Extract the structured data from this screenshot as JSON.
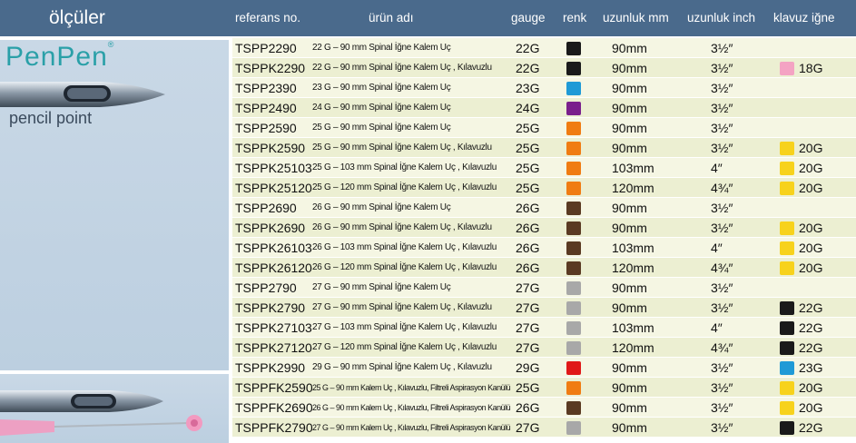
{
  "left": {
    "header": "ölçüler",
    "brand": "PenPen",
    "registered": "®",
    "tagline": "pencil point"
  },
  "columns": {
    "ref": "referans no.",
    "name": "ürün adı",
    "gauge": "gauge",
    "color": "renk",
    "length_mm": "uzunluk mm",
    "length_inch": "uzunluk inch",
    "guide": "klavuz iğne"
  },
  "colors": {
    "black": "#1a1a1a",
    "blue": "#1f9ad6",
    "purple": "#7a1f8c",
    "orange": "#f07c12",
    "brown": "#5a3a22",
    "gray": "#a8a8a8",
    "red": "#e01818",
    "pink": "#f4a3c3",
    "yellow": "#f7d21c",
    "header_bg": "#4a6a8c"
  },
  "rows": [
    {
      "ref": "TSPP2290",
      "name": "22 G – 90 mm Spinal İğne Kalem Uç",
      "gauge": "22G",
      "color": "#1a1a1a",
      "mm": "90mm",
      "inch": "3½″",
      "guide_color": "",
      "guide": ""
    },
    {
      "ref": "TSPPK2290",
      "name": "22 G – 90 mm Spinal İğne Kalem Uç , Kılavuzlu",
      "gauge": "22G",
      "color": "#1a1a1a",
      "mm": "90mm",
      "inch": "3½″",
      "guide_color": "#f4a3c3",
      "guide": "18G"
    },
    {
      "ref": "TSPP2390",
      "name": "23 G – 90 mm Spinal İğne Kalem Uç",
      "gauge": "23G",
      "color": "#1f9ad6",
      "mm": "90mm",
      "inch": "3½″",
      "guide_color": "",
      "guide": ""
    },
    {
      "ref": "TSPP2490",
      "name": "24 G – 90 mm Spinal İğne Kalem Uç",
      "gauge": "24G",
      "color": "#7a1f8c",
      "mm": "90mm",
      "inch": "3½″",
      "guide_color": "",
      "guide": ""
    },
    {
      "ref": "TSPP2590",
      "name": "25 G – 90 mm Spinal İğne Kalem Uç",
      "gauge": "25G",
      "color": "#f07c12",
      "mm": "90mm",
      "inch": "3½″",
      "guide_color": "",
      "guide": ""
    },
    {
      "ref": "TSPPK2590",
      "name": "25 G – 90 mm Spinal İğne Kalem Uç , Kılavuzlu",
      "gauge": "25G",
      "color": "#f07c12",
      "mm": "90mm",
      "inch": "3½″",
      "guide_color": "#f7d21c",
      "guide": "20G"
    },
    {
      "ref": "TSPPK25103",
      "name": "25 G – 103 mm Spinal İğne Kalem Uç , Kılavuzlu",
      "gauge": "25G",
      "color": "#f07c12",
      "mm": "103mm",
      "inch": "4″",
      "guide_color": "#f7d21c",
      "guide": "20G"
    },
    {
      "ref": "TSPPK25120",
      "name": "25 G – 120 mm Spinal İğne Kalem Uç , Kılavuzlu",
      "gauge": "25G",
      "color": "#f07c12",
      "mm": "120mm",
      "inch": "4¾″",
      "guide_color": "#f7d21c",
      "guide": "20G"
    },
    {
      "ref": "TSPP2690",
      "name": "26 G – 90 mm Spinal İğne Kalem Uç",
      "gauge": "26G",
      "color": "#5a3a22",
      "mm": "90mm",
      "inch": "3½″",
      "guide_color": "",
      "guide": ""
    },
    {
      "ref": "TSPPK2690",
      "name": "26 G – 90 mm Spinal İğne Kalem Uç , Kılavuzlu",
      "gauge": "26G",
      "color": "#5a3a22",
      "mm": "90mm",
      "inch": "3½″",
      "guide_color": "#f7d21c",
      "guide": "20G"
    },
    {
      "ref": "TSPPK26103",
      "name": "26 G – 103 mm Spinal İğne Kalem Uç , Kılavuzlu",
      "gauge": "26G",
      "color": "#5a3a22",
      "mm": "103mm",
      "inch": "4″",
      "guide_color": "#f7d21c",
      "guide": "20G"
    },
    {
      "ref": "TSPPK26120",
      "name": "26 G – 120 mm Spinal İğne Kalem Uç , Kılavuzlu",
      "gauge": "26G",
      "color": "#5a3a22",
      "mm": "120mm",
      "inch": "4¾″",
      "guide_color": "#f7d21c",
      "guide": "20G"
    },
    {
      "ref": "TSPP2790",
      "name": "27 G – 90 mm Spinal İğne Kalem Uç",
      "gauge": "27G",
      "color": "#a8a8a8",
      "mm": "90mm",
      "inch": "3½″",
      "guide_color": "",
      "guide": ""
    },
    {
      "ref": "TSPPK2790",
      "name": "27 G – 90 mm Spinal İğne Kalem Uç , Kılavuzlu",
      "gauge": "27G",
      "color": "#a8a8a8",
      "mm": "90mm",
      "inch": "3½″",
      "guide_color": "#1a1a1a",
      "guide": "22G"
    },
    {
      "ref": "TSPPK27103",
      "name": "27 G – 103 mm Spinal İğne Kalem Uç , Kılavuzlu",
      "gauge": "27G",
      "color": "#a8a8a8",
      "mm": "103mm",
      "inch": "4″",
      "guide_color": "#1a1a1a",
      "guide": "22G"
    },
    {
      "ref": "TSPPK27120",
      "name": "27 G – 120 mm Spinal İğne Kalem Uç , Kılavuzlu",
      "gauge": "27G",
      "color": "#a8a8a8",
      "mm": "120mm",
      "inch": "4¾″",
      "guide_color": "#1a1a1a",
      "guide": "22G"
    },
    {
      "ref": "TSPPK2990",
      "name": "29 G – 90 mm Spinal İğne Kalem Uç , Kılavuzlu",
      "gauge": "29G",
      "color": "#e01818",
      "mm": "90mm",
      "inch": "3½″",
      "guide_color": "#1f9ad6",
      "guide": "23G"
    },
    {
      "ref": "TSPPFK2590",
      "name": "25 G – 90 mm Kalem Uç , Kılavuzlu, Filtreli Aspirasyon Kanülü",
      "gauge": "25G",
      "color": "#f07c12",
      "mm": "90mm",
      "inch": "3½″",
      "guide_color": "#f7d21c",
      "guide": "20G"
    },
    {
      "ref": "TSPPFK2690",
      "name": "26 G – 90 mm Kalem Uç , Kılavuzlu, Filtreli Aspirasyon Kanülü",
      "gauge": "26G",
      "color": "#5a3a22",
      "mm": "90mm",
      "inch": "3½″",
      "guide_color": "#f7d21c",
      "guide": "20G"
    },
    {
      "ref": "TSPPFK2790",
      "name": "27 G – 90 mm Kalem Uç , Kılavuzlu, Filtreli Aspirasyon Kanülü",
      "gauge": "27G",
      "color": "#a8a8a8",
      "mm": "90mm",
      "inch": "3½″",
      "guide_color": "#1a1a1a",
      "guide": "22G"
    }
  ]
}
